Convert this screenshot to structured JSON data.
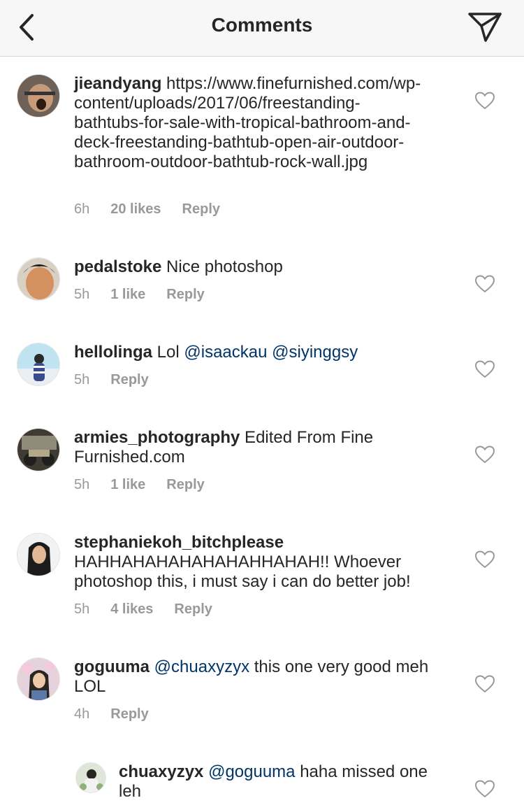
{
  "header": {
    "title": "Comments",
    "back_icon": "chevron-left-icon",
    "send_icon": "paper-plane-icon"
  },
  "comments": [
    {
      "user": "jieandyang",
      "text": " https://www.finefurnished.com/wp-content/uploads/2017/06/freestanding-bathtubs-for-sale-with-tropical-bathroom-and-deck-freestanding-bathtub-open-air-outdoor-bathroom-outdoor-bathtub-rock-wall.jpg",
      "time": "6h",
      "likes": "20 likes",
      "reply": "Reply"
    },
    {
      "user": "pedalstoke",
      "text": " Nice photoshop",
      "time": "5h",
      "likes": "1 like",
      "reply": "Reply"
    },
    {
      "user": "hellolinga",
      "text_pre": " Lol ",
      "mention1": "@isaackau",
      "mention2": "@siyinggsy",
      "time": "5h",
      "reply": "Reply"
    },
    {
      "user": "armies_photography",
      "text": " Edited From Fine Furnished.com",
      "time": "5h",
      "likes": "1 like",
      "reply": "Reply"
    },
    {
      "user": "stephaniekoh_bitchplease",
      "text": "HAHHAHAHAHAHAHAHHAHAH!! Whoever photoshop this, i must say i can do better job!",
      "time": "5h",
      "likes": "4 likes",
      "reply": "Reply"
    },
    {
      "user": "goguuma",
      "mention": "@chuaxyzyx",
      "text": " this one very good meh LOL",
      "time": "4h",
      "reply": "Reply"
    },
    {
      "user": "chuaxyzyx",
      "mention": "@goguuma",
      "text": " haha missed one leh"
    }
  ],
  "colors": {
    "text": "#262626",
    "meta": "#999999",
    "mention": "#003569",
    "header_bg": "#f7f7f7"
  }
}
